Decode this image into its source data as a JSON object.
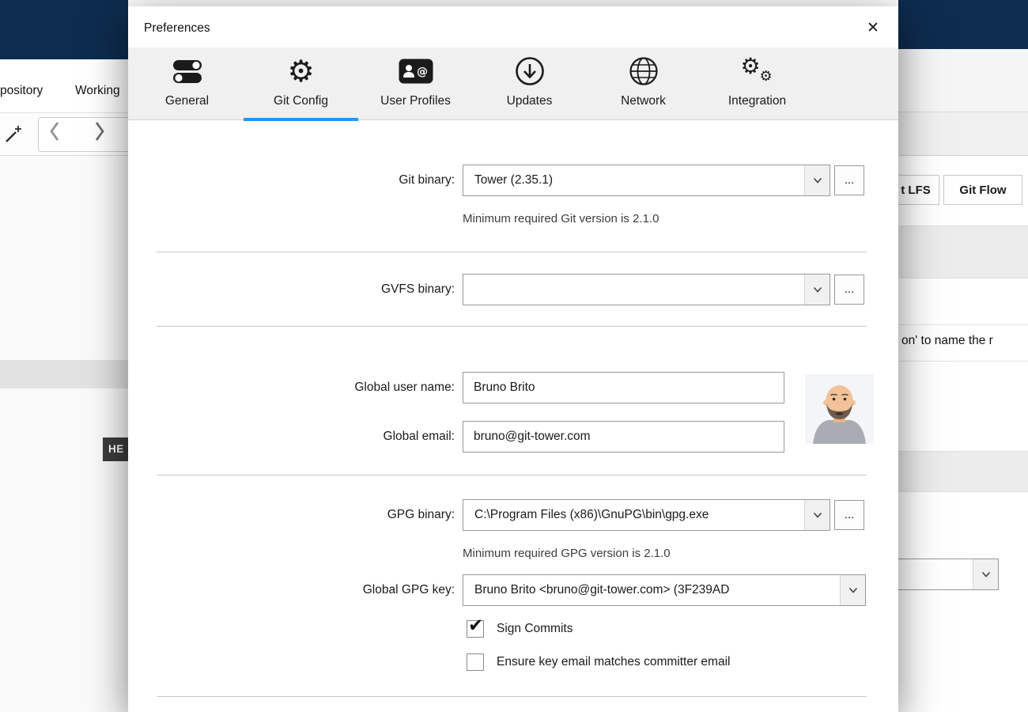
{
  "background": {
    "menu": {
      "item_left": "pository",
      "item_right": "Working"
    },
    "head_badge": "HE",
    "toolbar_right": {
      "git_lfs": "t LFS",
      "git_flow": "Git Flow"
    },
    "snippet_text": "on' to name the r"
  },
  "dialog": {
    "title": "Preferences",
    "icons": {
      "close": "✕",
      "check": "✔",
      "gear": "⚙"
    },
    "active_tab": "Git Config",
    "tabs": [
      {
        "label": "General"
      },
      {
        "label": "Git Config"
      },
      {
        "label": "User Profiles"
      },
      {
        "label": "Updates"
      },
      {
        "label": "Network"
      },
      {
        "label": "Integration"
      }
    ],
    "git_binary": {
      "label": "Git binary:",
      "value": "Tower (2.35.1)",
      "hint": "Minimum required Git version is 2.1.0",
      "browse": "..."
    },
    "gvfs_binary": {
      "label": "GVFS binary:",
      "value": "",
      "browse": "..."
    },
    "global_user_name": {
      "label": "Global user name:",
      "value": "Bruno Brito"
    },
    "global_email": {
      "label": "Global email:",
      "value": "bruno@git-tower.com"
    },
    "gpg_binary": {
      "label": "GPG binary:",
      "value": "C:\\Program Files (x86)\\GnuPG\\bin\\gpg.exe",
      "hint": "Minimum required GPG version is 2.1.0",
      "browse": "..."
    },
    "global_gpg_key": {
      "label": "Global GPG key:",
      "value": "Bruno Brito <bruno@git-tower.com> (3F239AD"
    },
    "sign_commits": {
      "label": "Sign Commits",
      "checked": true
    },
    "ensure_key_email": {
      "label": "Ensure key email matches committer email",
      "checked": false
    }
  }
}
